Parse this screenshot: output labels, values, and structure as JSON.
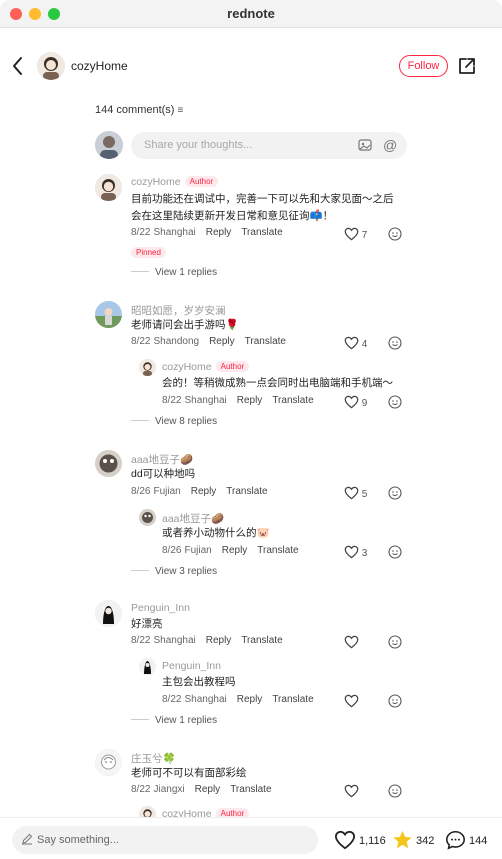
{
  "window": {
    "title": "rednote"
  },
  "header": {
    "author_name": "cozyHome",
    "follow_label": "Follow"
  },
  "comments_header": {
    "count_label": "144 comment(s)"
  },
  "composer": {
    "placeholder": "Share your thoughts..."
  },
  "comments": [
    {
      "name": "cozyHome",
      "badge": "Author",
      "text_line1": "目前功能还在调试中，完善一下可以先和大家见面～之后",
      "text_line2": "会在这里陆续更新开发日常和意见征询📫！",
      "date": "8/22",
      "location": "Shanghai",
      "reply": "Reply",
      "translate": "Translate",
      "likes": "7",
      "pinned": "Pinned",
      "view_replies": "View 1 replies"
    },
    {
      "name": "昭昭如愿，岁岁安澜",
      "text": "老师请问会出手游吗🌹",
      "date": "8/22",
      "location": "Shandong",
      "reply": "Reply",
      "translate": "Translate",
      "likes": "4",
      "reply_item": {
        "name": "cozyHome",
        "badge": "Author",
        "text": "会的！等稍微成熟一点会同时出电脑端和手机端～",
        "date": "8/22",
        "location": "Shanghai",
        "reply": "Reply",
        "translate": "Translate",
        "likes": "9"
      },
      "view_replies": "View 8 replies"
    },
    {
      "name": "aaa地豆子🥔",
      "text": "dd可以种地吗",
      "date": "8/26",
      "location": "Fujian",
      "reply": "Reply",
      "translate": "Translate",
      "likes": "5",
      "reply_item": {
        "name": "aaa地豆子🥔",
        "text": "或者养小动物什么的🐷",
        "date": "8/26",
        "location": "Fujian",
        "reply": "Reply",
        "translate": "Translate",
        "likes": "3"
      },
      "view_replies": "View 3 replies"
    },
    {
      "name": "Penguin_Inn",
      "text": "好漂亮",
      "date": "8/22",
      "location": "Shanghai",
      "reply": "Reply",
      "translate": "Translate",
      "reply_item": {
        "name": "Penguin_Inn",
        "text": "主包会出教程吗",
        "date": "8/22",
        "location": "Shanghai",
        "reply": "Reply",
        "translate": "Translate"
      },
      "view_replies": "View 1 replies"
    },
    {
      "name": "庄玉兮🍀",
      "text": "老师可不可以有面部彩绘",
      "date": "8/22",
      "location": "Jiangxi",
      "reply": "Reply",
      "translate": "Translate",
      "reply_item": {
        "name": "cozyHome",
        "badge": "Author"
      }
    }
  ],
  "bottom_bar": {
    "placeholder": "Say something...",
    "likes": "1,116",
    "stars": "342",
    "comments": "144"
  },
  "colors": {
    "accent": "#ff2442",
    "star": "#f5c518"
  }
}
